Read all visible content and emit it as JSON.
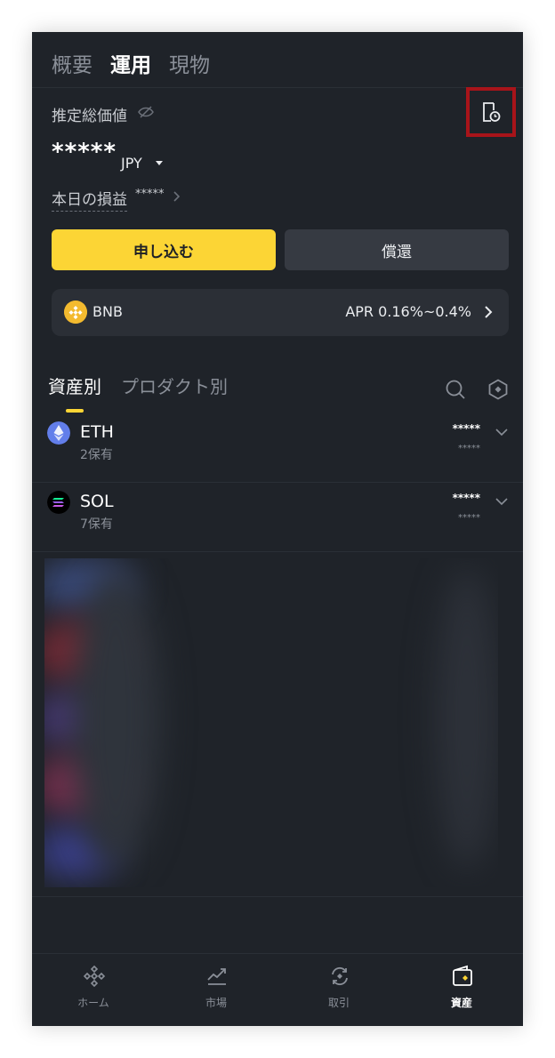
{
  "top_tabs": [
    {
      "label": "概要"
    },
    {
      "label": "運用"
    },
    {
      "label": "現物"
    }
  ],
  "header": {
    "total_label": "推定総価値",
    "total_value": "*****",
    "currency": "JPY",
    "pnl_label": "本日の損益",
    "pnl_value": "*****"
  },
  "actions": {
    "apply_label": "申し込む",
    "redeem_label": "償還"
  },
  "promo": {
    "coin": "BNB",
    "apr": "APR 0.16%~0.4%"
  },
  "sub_tabs": [
    {
      "label": "資産別"
    },
    {
      "label": "プロダクト別"
    }
  ],
  "assets": [
    {
      "name": "ETH",
      "holdings": "2保有",
      "amount": "*****",
      "sub_amount": "*****"
    },
    {
      "name": "SOL",
      "holdings": "7保有",
      "amount": "*****",
      "sub_amount": "*****"
    }
  ],
  "bottom_nav": [
    {
      "label": "ホーム"
    },
    {
      "label": "市場"
    },
    {
      "label": "取引"
    },
    {
      "label": "資産"
    }
  ],
  "colors": {
    "background": "#1f2329",
    "accent": "#fcd535",
    "card": "#2b2f36",
    "highlight_box": "#a8141a"
  }
}
